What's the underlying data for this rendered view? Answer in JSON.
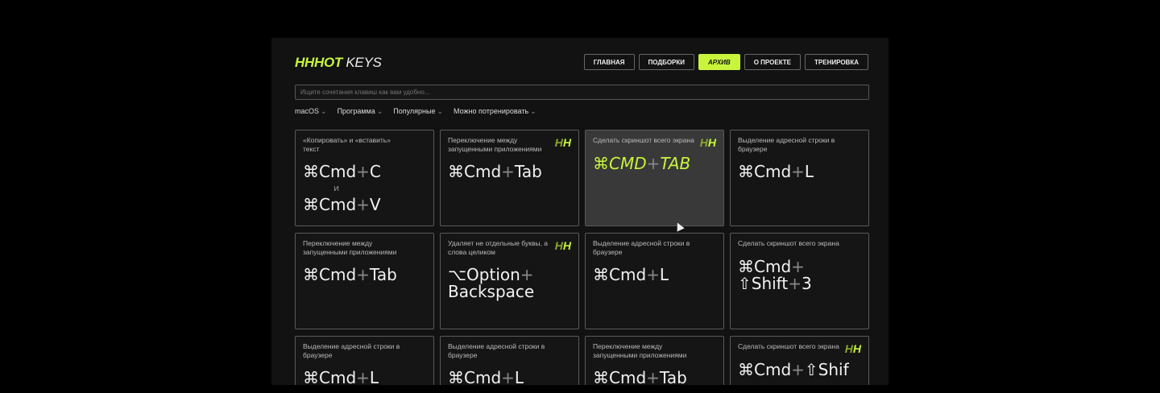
{
  "logo": {
    "mark": "HH",
    "bold": "HOT",
    "text": " KEYS"
  },
  "nav": [
    {
      "label": "ГЛАВНАЯ"
    },
    {
      "label": "ПОДБОРКИ"
    },
    {
      "label": "АРХИВ",
      "active": true
    },
    {
      "label": "О ПРОЕКТЕ"
    },
    {
      "label": "ТРЕНИРОВКА"
    }
  ],
  "search": {
    "placeholder": "Ищите сочетания клавиш как вам удобно..."
  },
  "filters": [
    {
      "label": "macOS"
    },
    {
      "label": "Программа"
    },
    {
      "label": "Популярные"
    },
    {
      "label": "Можно потренировать"
    }
  ],
  "colors": {
    "accent": "#c8f53c"
  },
  "cards": [
    {
      "desc": "«Копировать» и «вставить» текст",
      "keys": [
        [
          "⌘Cmd",
          "C"
        ],
        [
          "⌘Cmd",
          "V"
        ]
      ],
      "joiner": "и"
    },
    {
      "desc": "Переключение между запущенными приложениями",
      "keys": [
        [
          "⌘Cmd",
          "Tab"
        ]
      ],
      "badge": true
    },
    {
      "desc": "Сделать скриншот всего экрана",
      "keys": [
        [
          "⌘CMD",
          "TAB"
        ]
      ],
      "badge": true,
      "highlight": true
    },
    {
      "desc": "Выделение адресной строки в браузере",
      "keys": [
        [
          "⌘Cmd",
          "L"
        ]
      ]
    },
    {
      "desc": "Переключение между запущенными приложениями",
      "keys": [
        [
          "⌘Cmd",
          "Tab"
        ]
      ]
    },
    {
      "desc": "Удаляет не отдельные буквы, а слова целиком",
      "keys": [
        [
          "⌥Option",
          "Backspace"
        ]
      ],
      "badge": true,
      "wrap": true
    },
    {
      "desc": "Выделение адресной строки в браузере",
      "keys": [
        [
          "⌘Cmd",
          "L"
        ]
      ]
    },
    {
      "desc": "Сделать скриншот всего экрана",
      "keys": [
        [
          "⌘Cmd",
          "⇧Shift",
          "3"
        ]
      ],
      "wrap": true
    },
    {
      "desc": "Выделение адресной строки в браузере",
      "keys": [
        [
          "⌘Cmd",
          "L"
        ]
      ]
    },
    {
      "desc": "Выделение адресной строки в браузере",
      "keys": [
        [
          "⌘Cmd",
          "L"
        ]
      ]
    },
    {
      "desc": "Переключение между запущенными приложениями",
      "keys": [
        [
          "⌘Cmd",
          "Tab"
        ]
      ]
    },
    {
      "desc": "Сделать скриншот всего экрана",
      "keys": [
        [
          "⌘Cmd",
          "⇧Shif"
        ]
      ],
      "badge": true
    }
  ]
}
